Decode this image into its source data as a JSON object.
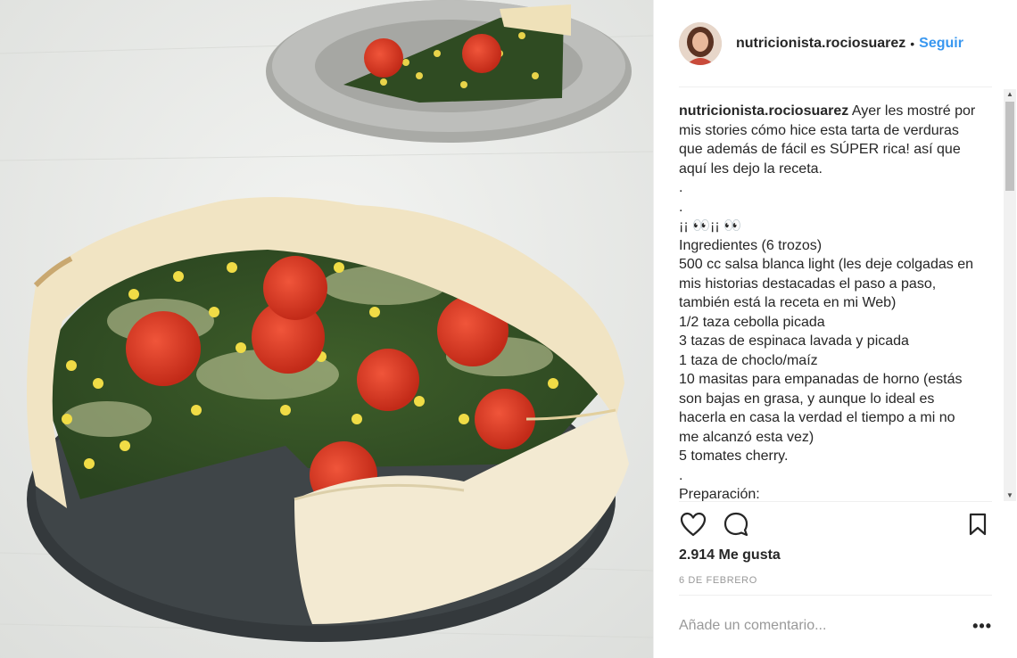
{
  "post": {
    "username": "nutricionista.rociosuarez",
    "dot": "•",
    "follow_label": "Seguir",
    "caption_user": "nutricionista.rociosuarez",
    "caption_text": " Ayer les mostré por mis stories cómo hice esta tarta de verduras que además de fácil es SÚPER rica! así que aquí les dejo la receta.\n.\n.\n¡¡ 👀¡¡ 👀\nIngredientes (6 trozos)\n500 cc salsa blanca light (les deje colgadas en mis historias destacadas el paso a paso, también está la receta en mi Web)\n1/2 taza cebolla picada\n3 tazas de espinaca lavada y picada\n1 taza de choclo/maíz\n10 masitas para empanadas de horno (estás son bajas en grasa, y aunque lo ideal es hacerla en casa la verdad el tiempo a mi no me alcanzó esta vez)\n5 tomates cherry.\n.\nPreparación:",
    "likes": "2.914 Me gusta",
    "date": "6 de febrero",
    "comment_placeholder": "Añade un comentario...",
    "more_label": "•••"
  },
  "icons": {
    "like": "heart-icon",
    "comment": "comment-bubble-icon",
    "save": "bookmark-icon",
    "scroll_up": "▲",
    "scroll_down": "▼"
  },
  "colors": {
    "link_blue": "#3897f0",
    "text": "#262626",
    "muted": "#999999"
  }
}
